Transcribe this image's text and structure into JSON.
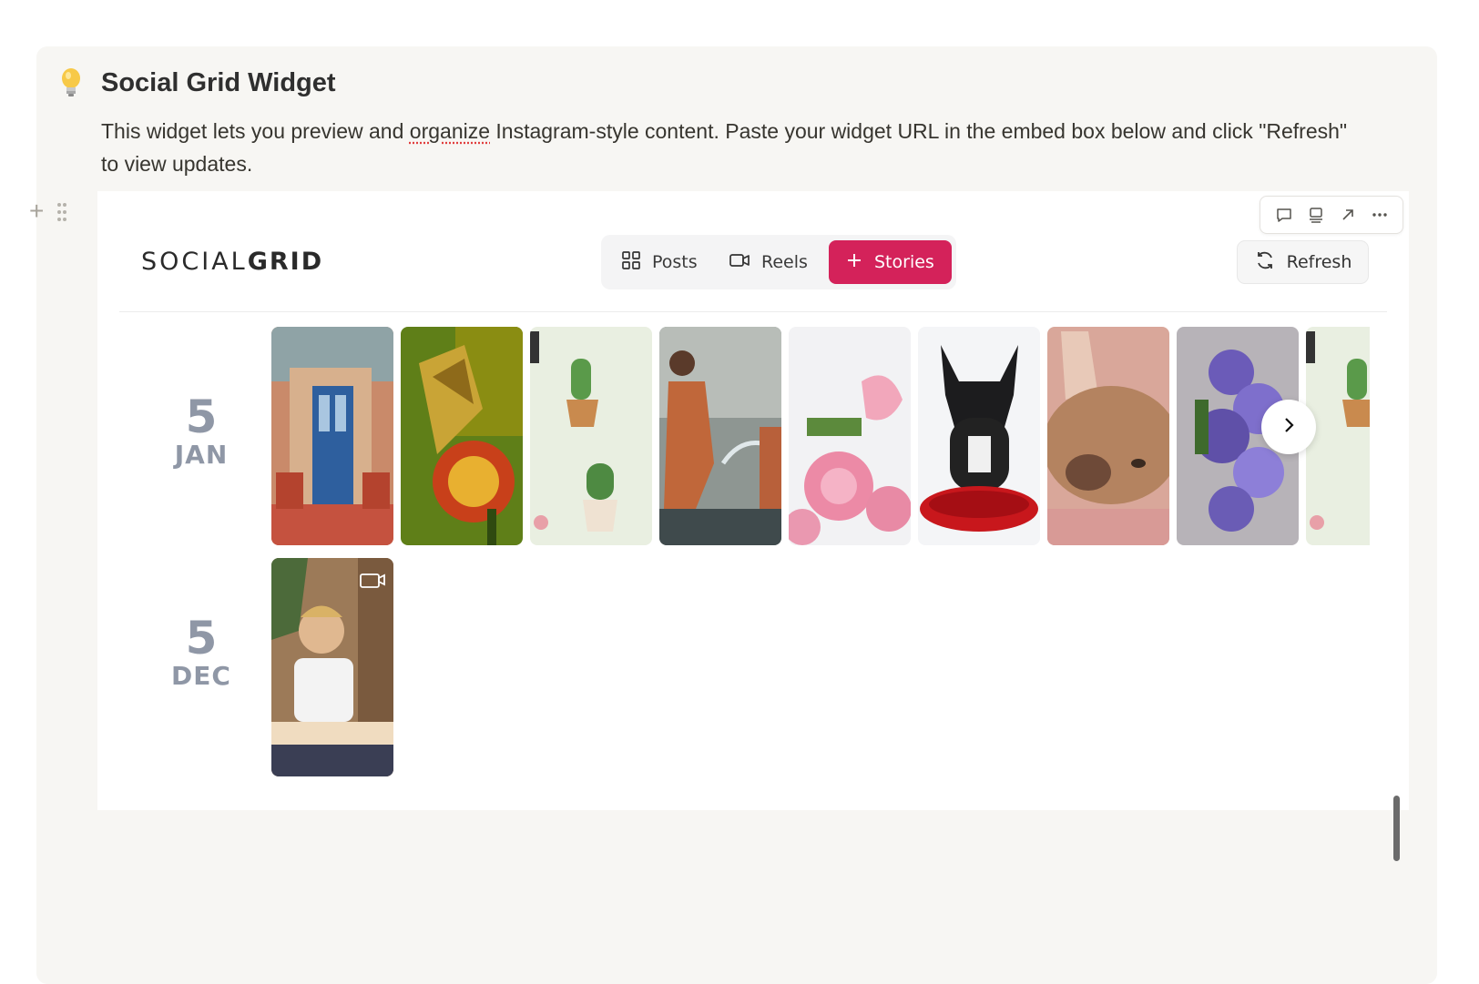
{
  "callout": {
    "icon": "lightbulb-icon",
    "title": "Social Grid Widget",
    "text_before": "This widget lets you preview and ",
    "text_misspelled": "organize",
    "text_after": " Instagram-style content. Paste your widget URL in the embed box below and click \"Refresh\" to view updates."
  },
  "embed_toolbar": {
    "icons": [
      "comment-icon",
      "caption-icon",
      "open-external-icon",
      "more-icon"
    ]
  },
  "widget": {
    "brand_light": "SOCIAL",
    "brand_bold": "GRID",
    "tabs": [
      {
        "label": "Posts",
        "icon": "grid-icon",
        "active": false
      },
      {
        "label": "Reels",
        "icon": "video-icon",
        "active": false
      },
      {
        "label": "Stories",
        "icon": "plus-icon",
        "active": true
      }
    ],
    "refresh_label": "Refresh",
    "accent_color": "#d4225a",
    "rows": [
      {
        "day": "5",
        "month": "JAN",
        "stories": [
          {
            "subject": "blue door storefront"
          },
          {
            "subject": "butterfly on marigold"
          },
          {
            "subject": "cactus pattern"
          },
          {
            "subject": "person pouring water"
          },
          {
            "subject": "pink roses"
          },
          {
            "subject": "french bulldog on red cushion"
          },
          {
            "subject": "resting fawn bulldog"
          },
          {
            "subject": "purple flowers"
          },
          {
            "subject": "cactus pattern"
          }
        ]
      },
      {
        "day": "5",
        "month": "DEC",
        "stories": [
          {
            "subject": "boy reading book",
            "video": true
          }
        ]
      }
    ]
  }
}
